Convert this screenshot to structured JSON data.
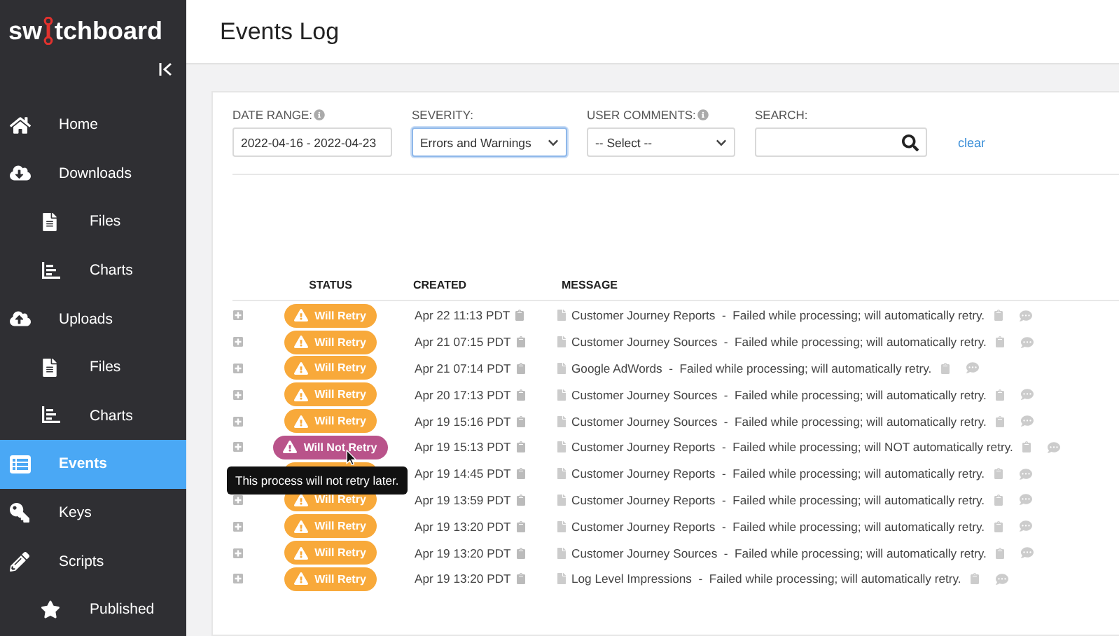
{
  "logo": {
    "before": "sw",
    "after": "tchboard"
  },
  "sidebar": {
    "items": [
      {
        "label": "Home",
        "kind": "home",
        "selected": false
      },
      {
        "label": "Downloads",
        "kind": "download",
        "selected": false,
        "children": [
          {
            "label": "Files",
            "kind": "file",
            "selected": false
          },
          {
            "label": "Charts",
            "kind": "chart",
            "selected": false
          }
        ]
      },
      {
        "label": "Uploads",
        "kind": "upload",
        "selected": false,
        "children": [
          {
            "label": "Files",
            "kind": "file",
            "selected": false
          },
          {
            "label": "Charts",
            "kind": "chart",
            "selected": false
          }
        ]
      },
      {
        "label": "Events",
        "kind": "events",
        "selected": true
      },
      {
        "label": "Keys",
        "kind": "key",
        "selected": false
      },
      {
        "label": "Scripts",
        "kind": "pencil",
        "selected": false,
        "children": [
          {
            "label": "Published",
            "kind": "star",
            "selected": false
          }
        ]
      }
    ]
  },
  "page_title": "Events Log",
  "filters": {
    "date_range": {
      "label": "DATE RANGE:",
      "value": "2022-04-16 - 2022-04-23"
    },
    "severity": {
      "label": "SEVERITY:",
      "value": "Errors and Warnings",
      "focused": true
    },
    "user_comments": {
      "label": "USER COMMENTS:",
      "value": "-- Select --"
    },
    "search": {
      "label": "SEARCH:"
    },
    "clear": "clear"
  },
  "table": {
    "columns": [
      "STATUS",
      "CREATED",
      "MESSAGE"
    ],
    "rows": [
      {
        "status": "Will Retry",
        "kind": "retry",
        "created": "Apr 22 11:13 PDT",
        "message": "Customer Journey Reports  -  Failed while processing; will automatically retry."
      },
      {
        "status": "Will Retry",
        "kind": "retry",
        "created": "Apr 21 07:15 PDT",
        "message": "Customer Journey Sources  -  Failed while processing; will automatically retry."
      },
      {
        "status": "Will Retry",
        "kind": "retry",
        "created": "Apr 21 07:14 PDT",
        "message": "Google AdWords  -  Failed while processing; will automatically retry."
      },
      {
        "status": "Will Retry",
        "kind": "retry",
        "created": "Apr 20 17:13 PDT",
        "message": "Customer Journey Sources  -  Failed while processing; will automatically retry."
      },
      {
        "status": "Will Retry",
        "kind": "retry",
        "created": "Apr 19 15:16 PDT",
        "message": "Customer Journey Sources  -  Failed while processing; will automatically retry."
      },
      {
        "status": "Will Not Retry",
        "kind": "no_retry",
        "created": "Apr 19 15:13 PDT",
        "message": "Customer Journey Reports  -  Failed while processing; will NOT automatically retry.",
        "tooltip": "This process will not retry later."
      },
      {
        "kind": "retry",
        "created": "Apr 19 14:45 PDT",
        "message": "Customer Journey Reports  -  Failed while processing; will automatically retry."
      },
      {
        "status": "Will Retry",
        "kind": "retry",
        "created": "Apr 19 13:59 PDT",
        "message": "Customer Journey Reports  -  Failed while processing; will automatically retry."
      },
      {
        "status": "Will Retry",
        "kind": "retry",
        "created": "Apr 19 13:20 PDT",
        "message": "Customer Journey Reports  -  Failed while processing; will automatically retry."
      },
      {
        "status": "Will Retry",
        "kind": "retry",
        "created": "Apr 19 13:20 PDT",
        "message": "Customer Journey Sources  -  Failed while processing; will automatically retry."
      },
      {
        "status": "Will Retry",
        "kind": "retry",
        "created": "Apr 19 13:20 PDT",
        "message": "Log Level Impressions  -  Failed while processing; will automatically retry."
      }
    ]
  }
}
